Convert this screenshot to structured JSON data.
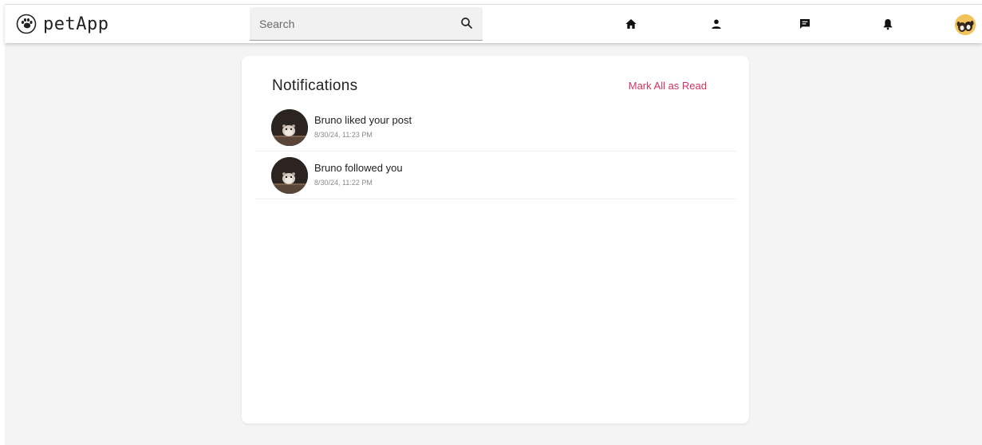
{
  "app": {
    "name": "petApp"
  },
  "search": {
    "placeholder": "Search"
  },
  "nav": {
    "icons": [
      "home-icon",
      "profile-icon",
      "messages-icon",
      "notifications-icon"
    ],
    "avatar": "user-avatar"
  },
  "notifications": {
    "title": "Notifications",
    "mark_all_label": "Mark All as Read",
    "accent_color": "#d2335c",
    "items": [
      {
        "message": "Bruno liked your post",
        "time": "8/30/24, 11:23 PM"
      },
      {
        "message": "Bruno followed you",
        "time": "8/30/24, 11:22 PM"
      }
    ]
  }
}
